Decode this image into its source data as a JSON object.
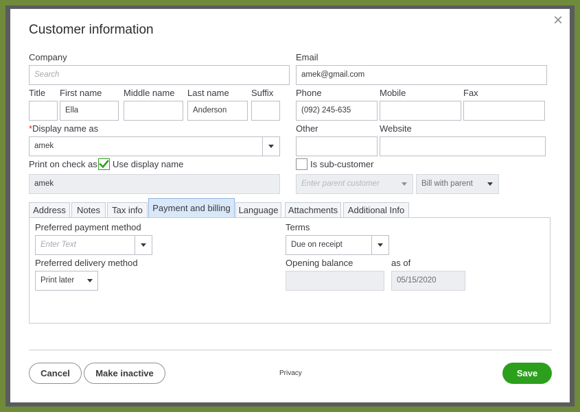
{
  "dialog": {
    "title": "Customer information",
    "close_glyph": "×"
  },
  "company": {
    "label": "Company",
    "placeholder": "Search"
  },
  "email": {
    "label": "Email",
    "value": "amek@gmail.com"
  },
  "name": {
    "title_label": "Title",
    "title_value": "",
    "first_label": "First name",
    "first_value": "Ella",
    "middle_label": "Middle name",
    "middle_value": "",
    "last_label": "Last name",
    "last_value": "Anderson",
    "suffix_label": "Suffix",
    "suffix_value": ""
  },
  "contact": {
    "phone_label": "Phone",
    "phone_value": "(092) 245-635",
    "mobile_label": "Mobile",
    "mobile_value": "",
    "fax_label": "Fax",
    "fax_value": "",
    "other_label": "Other",
    "other_value": "",
    "website_label": "Website",
    "website_value": ""
  },
  "display_name": {
    "required_mark": "*",
    "label": "Display name as",
    "value": "amek"
  },
  "print_on_check": {
    "label": "Print on check as",
    "checkbox_label": "Use display name",
    "checked": true,
    "value": "amek"
  },
  "sub_customer": {
    "checkbox_label": "Is sub-customer",
    "checked": false,
    "parent_placeholder": "Enter parent customer",
    "bill_value": "Bill with parent"
  },
  "tabs": [
    {
      "label": "Address"
    },
    {
      "label": "Notes"
    },
    {
      "label": "Tax info"
    },
    {
      "label": "Payment and billing",
      "active": true
    },
    {
      "label": "Language"
    },
    {
      "label": "Attachments"
    },
    {
      "label": "Additional Info"
    }
  ],
  "payment": {
    "method_label": "Preferred payment method",
    "method_placeholder": "Enter Text",
    "delivery_label": "Preferred delivery method",
    "delivery_value": "Print later",
    "terms_label": "Terms",
    "terms_value": "Due on receipt",
    "opening_label": "Opening balance",
    "opening_value": "",
    "asof_label": "as of",
    "asof_value": "05/15/2020"
  },
  "footer": {
    "cancel_label": "Cancel",
    "inactive_label": "Make inactive",
    "privacy_label": "Privacy",
    "save_label": "Save"
  },
  "colors": {
    "accent_green": "#2ca01c",
    "required_red": "#d52b1e",
    "active_tab": "#d9e8f8",
    "frame_green": "#6f8a3a"
  },
  "icons": {
    "close": "close-icon",
    "dropdown": "chevron-down-icon",
    "check": "checkmark-icon"
  }
}
